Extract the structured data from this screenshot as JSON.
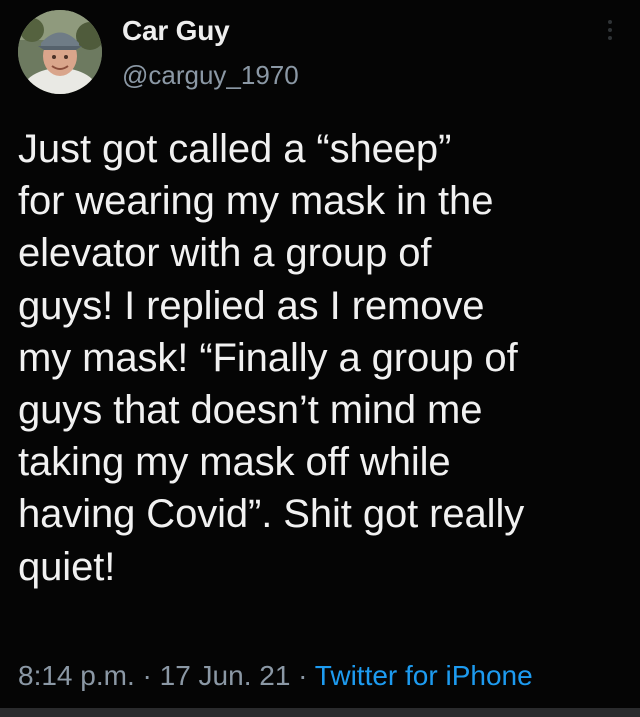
{
  "user": {
    "display_name": "Car Guy",
    "handle": "@carguy_1970",
    "avatar_icon": "profile-photo-man-in-cap"
  },
  "tweet": {
    "text": "Just got called a “sheep”\nfor wearing my mask in the\nelevator with a group of\nguys! I replied as I remove\nmy mask! “Finally a group of\nguys that doesn’t mind me\ntaking my mask off while\nhaving Covid”.  Shit got really\nquiet!",
    "time": "8:14 p.m.",
    "separator": " · ",
    "date": "17 Jun. 21",
    "source": "Twitter for iPhone"
  },
  "icons": {
    "more": "more-vertical-icon"
  },
  "colors": {
    "background": "#050505",
    "text": "#f1f1f1",
    "secondary_text": "#8b98a5",
    "link": "#1d9bf0"
  }
}
